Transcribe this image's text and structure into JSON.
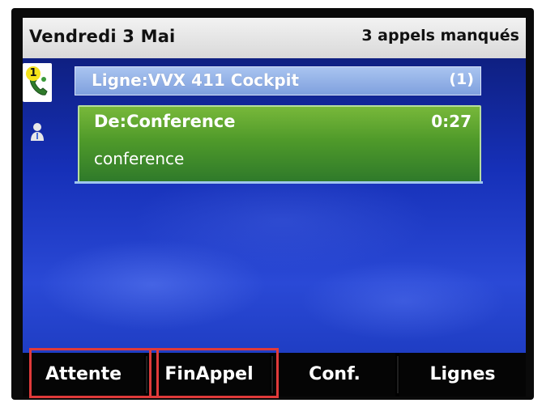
{
  "status_bar": {
    "date": "Vendredi 3 Mai",
    "missed_calls": "3 appels manqués"
  },
  "sidebar": {
    "calls_badge": "1"
  },
  "line": {
    "label": "Ligne:VVX 411 Cockpit",
    "count": "(1)"
  },
  "call": {
    "from": "De:Conference",
    "timer": "0:27",
    "name": "conference"
  },
  "softkeys": [
    {
      "label": "Attente",
      "highlighted": true
    },
    {
      "label": "FinAppel",
      "highlighted": true
    },
    {
      "label": "Conf.",
      "highlighted": false
    },
    {
      "label": "Lignes",
      "highlighted": false
    }
  ],
  "colors": {
    "highlight": "#e03a3a",
    "call_active": "#4f9a2a",
    "line_header": "#7fa0de",
    "badge": "#f4e21a"
  },
  "icons": {
    "calls_tab": "phone-handset-icon",
    "contacts_tab": "person-icon"
  }
}
